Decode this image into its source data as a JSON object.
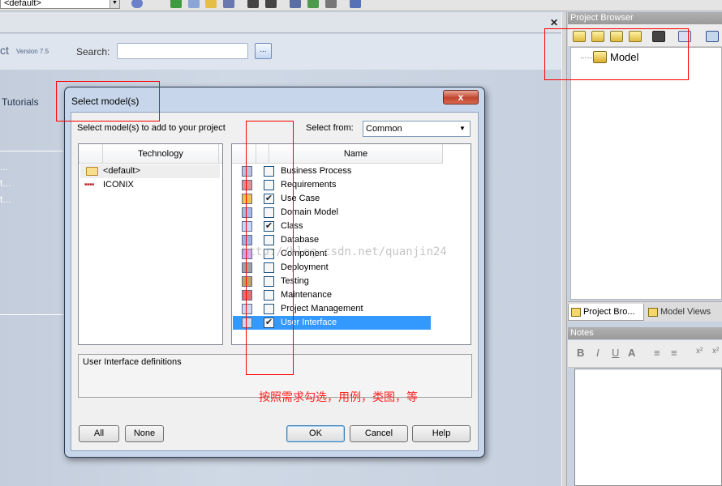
{
  "toolbar": {
    "combo_value": "<default>"
  },
  "startpage": {
    "title_fragment": "ct",
    "version": "Version 7.5",
    "search_label": "Search:",
    "search_button": "...",
    "tutorials": "Tutorials",
    "dots": [
      "...",
      "t...",
      "t..."
    ]
  },
  "project_browser": {
    "title": "Project Browser",
    "tree": [
      {
        "label": "Model"
      }
    ],
    "tabs": [
      "Project Bro...",
      "Model Views"
    ]
  },
  "notes": {
    "title": "Notes",
    "toolbar": [
      "B",
      "I",
      "U",
      "A",
      "≡",
      "≡",
      "x²",
      "x²"
    ]
  },
  "dialog": {
    "title": "Select model(s)",
    "close": "x",
    "instruction": "Select model(s) to add to your project",
    "select_from_label": "Select from:",
    "select_from_value": "Common",
    "technology_header": "Technology",
    "technologies": [
      {
        "label": "<default>",
        "icon": "folder-icon",
        "selected": true
      },
      {
        "label": "ICONIX",
        "icon": "iconix-icon",
        "selected": false
      }
    ],
    "name_header": "Name",
    "models": [
      {
        "label": "Business Process",
        "checked": false
      },
      {
        "label": "Requirements",
        "checked": false
      },
      {
        "label": "Use Case",
        "checked": true
      },
      {
        "label": "Domain Model",
        "checked": false
      },
      {
        "label": "Class",
        "checked": true
      },
      {
        "label": "Database",
        "checked": false
      },
      {
        "label": "Component",
        "checked": false
      },
      {
        "label": "Deployment",
        "checked": false
      },
      {
        "label": "Testing",
        "checked": false
      },
      {
        "label": "Maintenance",
        "checked": false
      },
      {
        "label": "Project Management",
        "checked": false
      },
      {
        "label": "User Interface",
        "checked": true,
        "selected": true
      }
    ],
    "description": "User Interface definitions",
    "buttons": {
      "all": "All",
      "none": "None",
      "ok": "OK",
      "cancel": "Cancel",
      "help": "Help"
    }
  },
  "annotation": {
    "text": "按照需求勾选，用例，类图，等",
    "color": "#ff0000"
  },
  "watermark": "http://blog.csdn.net/quanjin24"
}
